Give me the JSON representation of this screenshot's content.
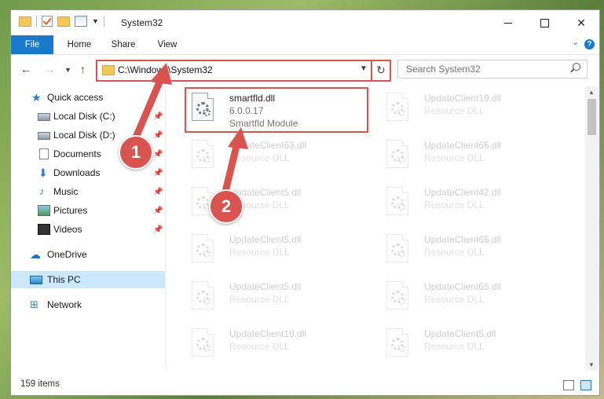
{
  "window": {
    "title": "System32"
  },
  "ribbon": {
    "tabs": [
      "File",
      "Home",
      "Share",
      "View"
    ]
  },
  "address": {
    "path": "C:\\Windows\\System32"
  },
  "search": {
    "placeholder": "Search System32"
  },
  "sidebar": {
    "items": [
      {
        "label": "Quick access",
        "icon": "star-icon"
      },
      {
        "label": "Local Disk (C:)",
        "icon": "drive-icon",
        "pinned": true
      },
      {
        "label": "Local Disk (D:)",
        "icon": "drive-icon",
        "pinned": true
      },
      {
        "label": "Documents",
        "icon": "documents-icon",
        "pinned": true
      },
      {
        "label": "Downloads",
        "icon": "download-icon",
        "pinned": true
      },
      {
        "label": "Music",
        "icon": "music-icon",
        "pinned": true
      },
      {
        "label": "Pictures",
        "icon": "pictures-icon",
        "pinned": true
      },
      {
        "label": "Videos",
        "icon": "video-icon",
        "pinned": true
      },
      {
        "label": "OneDrive",
        "icon": "cloud-icon"
      },
      {
        "label": "This PC",
        "icon": "computer-icon",
        "selected": true
      },
      {
        "label": "Network",
        "icon": "network-icon"
      }
    ]
  },
  "files": {
    "highlighted": {
      "name": "smartfld.dll",
      "version": "6.0.0.17",
      "description": "Smartfld Module"
    },
    "left_column": [
      {
        "name": "UpdateClient63.dll",
        "type": "Resource DLL"
      },
      {
        "name": "UpdateClient5.dll",
        "type": "Resource DLL"
      },
      {
        "name": "UpdateClient5.dll",
        "type": "Resource DLL"
      },
      {
        "name": "UpdateClient5.dll",
        "type": "Resource DLL"
      },
      {
        "name": "UpdateClient19.dll",
        "type": "Resource DLL"
      }
    ],
    "right_column": [
      {
        "name": "UpdateClient19.dll",
        "type": "Resource DLL"
      },
      {
        "name": "UpdateClient65.dll",
        "type": "Resource DLL"
      },
      {
        "name": "UpdateClient42.dll",
        "type": "Resource DLL"
      },
      {
        "name": "UpdateClient65.dll",
        "type": "Resource DLL"
      },
      {
        "name": "UpdateClient65.dll",
        "type": "Resource DLL"
      },
      {
        "name": "UpdateClient5.dll",
        "type": "Resource DLL"
      }
    ]
  },
  "status": {
    "item_count": "159 items"
  },
  "annotations": {
    "badge_1": "1",
    "badge_2": "2",
    "color": "#d9534f"
  },
  "colors": {
    "accent": "#1979ca",
    "selected_bg": "#cce8ff",
    "highlight": "#d9534f"
  }
}
